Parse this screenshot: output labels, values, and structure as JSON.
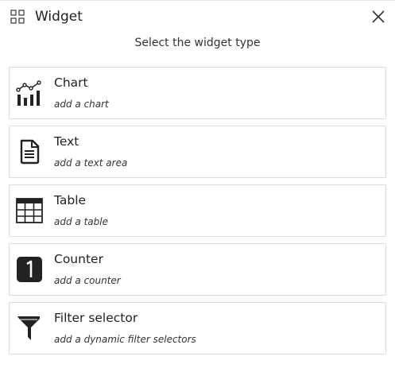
{
  "dialog": {
    "title": "Widget",
    "title_icon": "widget-grid-icon",
    "close_icon": "close-icon",
    "subtitle": "Select the widget type"
  },
  "options": [
    {
      "label": "Chart",
      "description": "add a chart",
      "icon": "chart-icon"
    },
    {
      "label": "Text",
      "description": "add a text area",
      "icon": "text-document-icon"
    },
    {
      "label": "Table",
      "description": "add a table",
      "icon": "table-icon"
    },
    {
      "label": "Counter",
      "description": "add a counter",
      "icon": "counter-icon"
    },
    {
      "label": "Filter selector",
      "description": "add a dynamic filter selectors",
      "icon": "filter-icon"
    }
  ],
  "colors": {
    "icon": "#222222",
    "border": "#dcdcdc",
    "text": "#222222"
  }
}
